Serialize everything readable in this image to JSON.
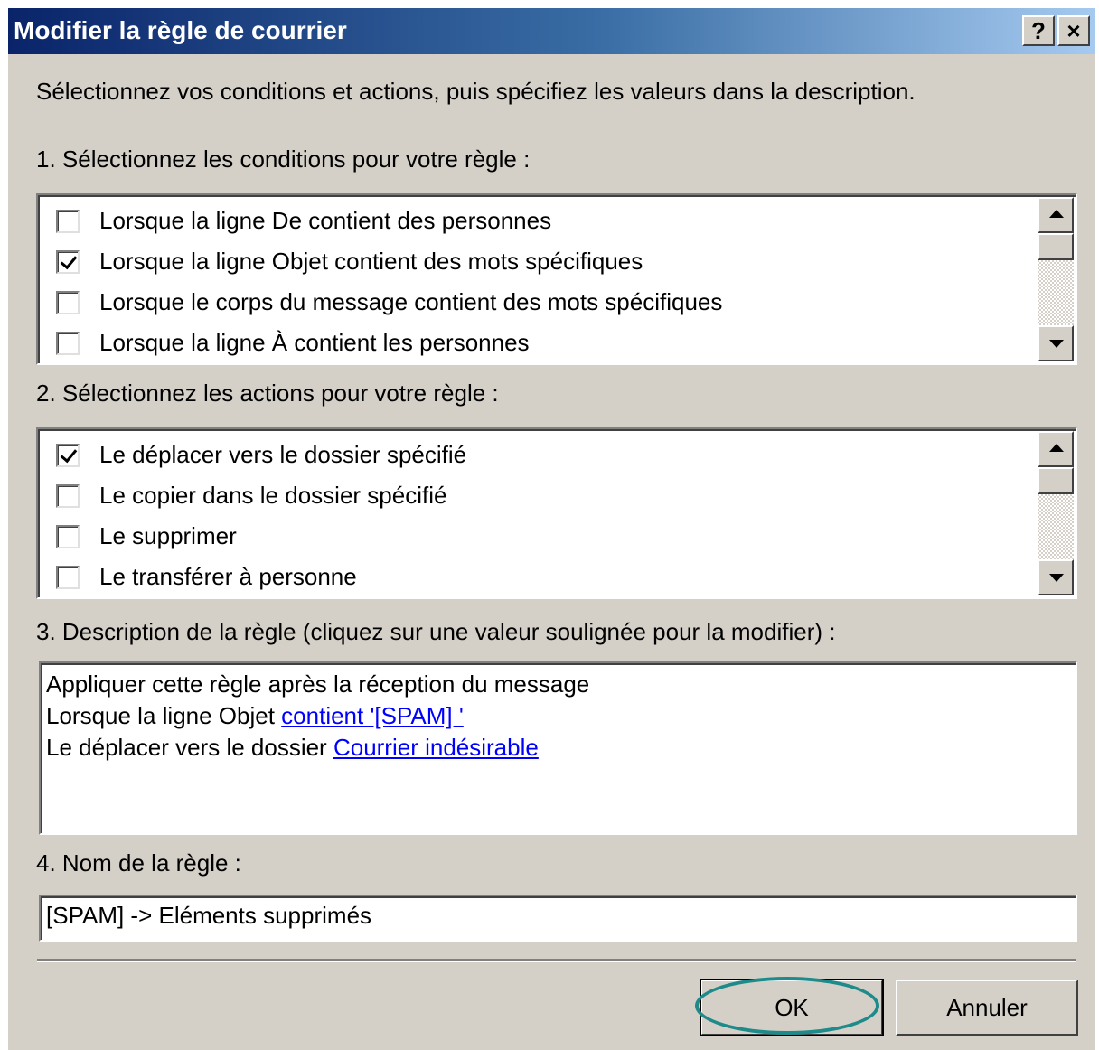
{
  "window": {
    "title": "Modifier la règle de courrier",
    "help_label": "?",
    "close_label": "×"
  },
  "intro_text": "Sélectionnez vos conditions et actions, puis spécifiez les valeurs dans la description.",
  "conditions": {
    "label": "1. Sélectionnez les conditions pour votre règle :",
    "items": [
      {
        "label": "Lorsque la ligne De contient des personnes",
        "checked": false
      },
      {
        "label": "Lorsque la ligne Objet contient des mots spécifiques",
        "checked": true
      },
      {
        "label": "Lorsque le corps du message contient des mots spécifiques",
        "checked": false
      },
      {
        "label": "Lorsque la ligne À contient les personnes",
        "checked": false
      }
    ]
  },
  "actions": {
    "label": "2. Sélectionnez les actions pour votre règle :",
    "items": [
      {
        "label": "Le déplacer vers le dossier spécifié",
        "checked": true
      },
      {
        "label": "Le copier dans le dossier spécifié",
        "checked": false
      },
      {
        "label": "Le supprimer",
        "checked": false
      },
      {
        "label": "Le transférer à personne",
        "checked": false
      }
    ]
  },
  "description": {
    "label": "3. Description de la règle (cliquez sur une valeur soulignée pour la modifier) :",
    "line1": "Appliquer cette règle après la réception du message",
    "line2_prefix": "Lorsque la ligne Objet ",
    "line2_link": "contient '[SPAM] '",
    "line3_prefix": "Le déplacer vers le dossier ",
    "line3_link": "Courrier indésirable"
  },
  "rule_name": {
    "label": "4. Nom de la règle :",
    "value": "[SPAM] -> Eléments supprimés"
  },
  "buttons": {
    "ok": "OK",
    "cancel": "Annuler"
  },
  "colors": {
    "titlebar_start": "#0a246a",
    "titlebar_end": "#a6caf0",
    "dialog_bg": "#d4d0c8",
    "link": "#0000ff",
    "annotation_ring": "#1e8a8a"
  }
}
